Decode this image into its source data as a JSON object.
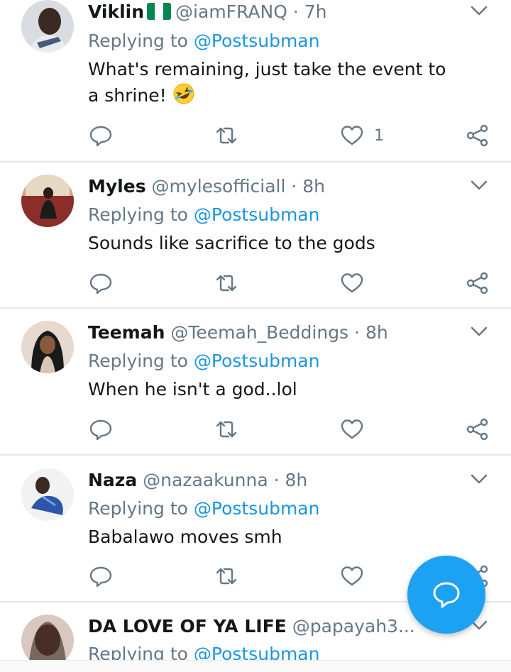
{
  "colors": {
    "accent": "#1da1f2",
    "mention": "#1b95e0",
    "muted": "#657786",
    "divider": "#e1e8ed"
  },
  "tweets": [
    {
      "name": "Viklin",
      "flag": "nigeria-flag",
      "handle": "@iamFRANQ",
      "dot": "·",
      "time": "7h",
      "replying_prefix": "Replying to",
      "replying_handle": "@Postsubman",
      "text": "What's remaining, just take the event to a shrine!",
      "emoji": "rolling-on-floor-laughing-emoji",
      "like_count": "1"
    },
    {
      "name": "Myles",
      "handle": "@mylesofficiall",
      "dot": "·",
      "time": "8h",
      "replying_prefix": "Replying to",
      "replying_handle": "@Postsubman",
      "text": "Sounds like sacrifice to the gods"
    },
    {
      "name": "Teemah",
      "handle": "@Teemah_Beddings",
      "dot": "·",
      "time": "8h",
      "replying_prefix": "Replying to",
      "replying_handle": "@Postsubman",
      "text": "When he isn't a god..lol"
    },
    {
      "name": "Naza",
      "handle": "@nazaakunna",
      "dot": "·",
      "time": "8h",
      "replying_prefix": "Replying to",
      "replying_handle": "@Postsubman",
      "text": "Babalawo moves smh"
    },
    {
      "name": "DA LOVE OF YA LIFE",
      "handle": "@papayah3...",
      "replying_prefix": "Replying to",
      "replying_handle": "@Postsubman"
    }
  ],
  "icons": {
    "reply": "reply-icon",
    "retweet": "retweet-icon",
    "like": "heart-icon",
    "share": "share-icon",
    "caret": "chevron-down-icon",
    "compose": "compose-reply-icon"
  }
}
